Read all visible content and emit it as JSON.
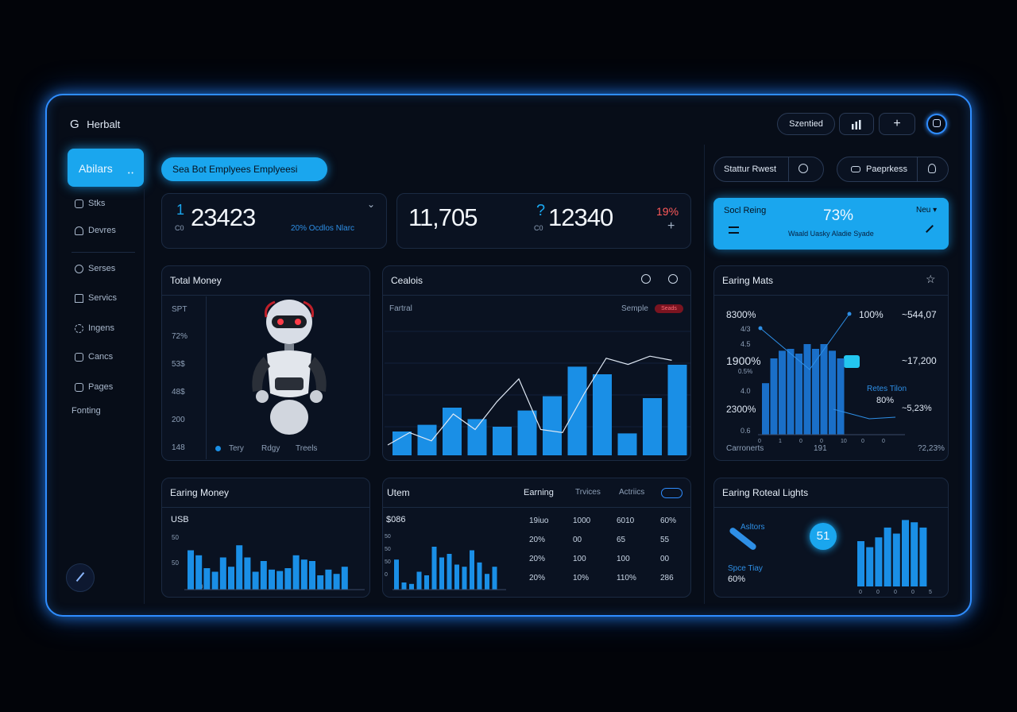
{
  "header": {
    "logo_glyph": "G",
    "brand": "Herbalt",
    "btn_sentied": "Szentied",
    "btn_chart_icon": "bar-chart-icon",
    "btn_plus": "+",
    "avatar_icon": "profile-icon"
  },
  "sidebar": {
    "active": "Abilars",
    "active_dots": "• •",
    "items": [
      {
        "label": "Stks",
        "icon": "home-icon"
      },
      {
        "label": "Devres",
        "icon": "user-icon"
      },
      {
        "label": "Serses",
        "icon": "globe-icon"
      },
      {
        "label": "Servics",
        "icon": "warning-icon"
      },
      {
        "label": "Ingens",
        "icon": "gear-icon"
      },
      {
        "label": "Cancs",
        "icon": "grid-icon"
      },
      {
        "label": "Pages",
        "icon": "page-icon"
      }
    ],
    "footer_label": "Fonting",
    "edit_icon": "pencil-icon"
  },
  "banner": {
    "label": "Sea Bot Emplyees Emplyeesi"
  },
  "stats": {
    "s1": {
      "prefix_top": "1",
      "prefix_bottom": "C0",
      "value": "23423",
      "sub": "20% Ocdlos Nlarc",
      "chevron": "⌄"
    },
    "s2": {
      "value": "11,705"
    },
    "s3": {
      "prefix_top": "?",
      "prefix_bottom": "C0",
      "value": "12340",
      "percent": "19%",
      "plus": "+"
    }
  },
  "right_pills": {
    "status": "Stattur Rwest",
    "feedback": "Paeprkess"
  },
  "score": {
    "title": "Socl Reing",
    "value": "73%",
    "caption": "Waald Uasky Aladie Syade",
    "dropdown": "Neu ▾"
  },
  "total_money": {
    "title": "Total Money",
    "yticks": [
      "SPT",
      "72%",
      "53$",
      "48$",
      "200",
      "148"
    ],
    "legend": [
      "Tery",
      "Rdgy",
      "Treels"
    ]
  },
  "cealois": {
    "title": "Cealois",
    "subtitle": "Fartral",
    "sample_label": "Semple",
    "sample_badge": "Seads"
  },
  "earing_mats": {
    "title": "Earing Mats",
    "left_labels": [
      "8300%",
      "4/3",
      "4.5",
      "1900%",
      "0.5%",
      "4.0",
      "2300%",
      "0.6"
    ],
    "right_labels": [
      "100%",
      "~544,07",
      "~17,200",
      "Retes Tilon",
      "80%",
      "~5,23%"
    ],
    "xticks": [
      "0",
      "1",
      "0",
      "0",
      "10",
      "0",
      "0"
    ],
    "footer": [
      "Carronerts",
      "191",
      "?2,23%"
    ]
  },
  "earing_money": {
    "title": "Earing Money",
    "ylabel": "USB",
    "yticks": [
      "50",
      "50",
      "0"
    ]
  },
  "utem": {
    "title": "Utem",
    "tabs": [
      "Earning",
      "Trvices",
      "Actriics"
    ],
    "chart_label": "$086",
    "yticks": [
      "50",
      "50",
      "50",
      "0"
    ],
    "rows": [
      [
        "19iuo",
        "1000",
        "6010",
        "60%"
      ],
      [
        "20%",
        "00",
        "65",
        "55"
      ],
      [
        "20%",
        "100",
        "100",
        "00"
      ],
      [
        "20%",
        "10%",
        "110%",
        "286"
      ]
    ]
  },
  "lights": {
    "title": "Earing Roteal Lights",
    "label1": "Asltors",
    "badge": "51",
    "label2": "Spce Tiay",
    "label3": "60%",
    "xticks": [
      "0",
      "0",
      "0",
      "0",
      "5"
    ]
  },
  "chart_data": [
    {
      "type": "bar",
      "title": "Cealois",
      "values": [
        25,
        32,
        50,
        38,
        30,
        47,
        62,
        93,
        85,
        23,
        60,
        95
      ],
      "line": [
        10,
        22,
        14,
        40,
        25,
        52,
        74,
        25,
        22,
        60,
        94,
        88,
        96,
        92
      ]
    },
    {
      "type": "bar",
      "title": "Earing Mats",
      "values": [
        54,
        80,
        88,
        90,
        85,
        95,
        90,
        95,
        88,
        80
      ]
    },
    {
      "type": "bar",
      "title": "Earing Money",
      "values": [
        55,
        48,
        30,
        25,
        45,
        32,
        62,
        45,
        25,
        40,
        28,
        26,
        30,
        48,
        42,
        40,
        20,
        28,
        22,
        32
      ]
    },
    {
      "type": "bar",
      "title": "Utem",
      "values": [
        42,
        10,
        8,
        25,
        20,
        60,
        45,
        50,
        35,
        32,
        55,
        38,
        22,
        32
      ]
    },
    {
      "type": "bar",
      "title": "Earing Roteal Lights",
      "values": [
        60,
        52,
        65,
        78,
        70,
        88,
        85,
        78
      ]
    }
  ]
}
